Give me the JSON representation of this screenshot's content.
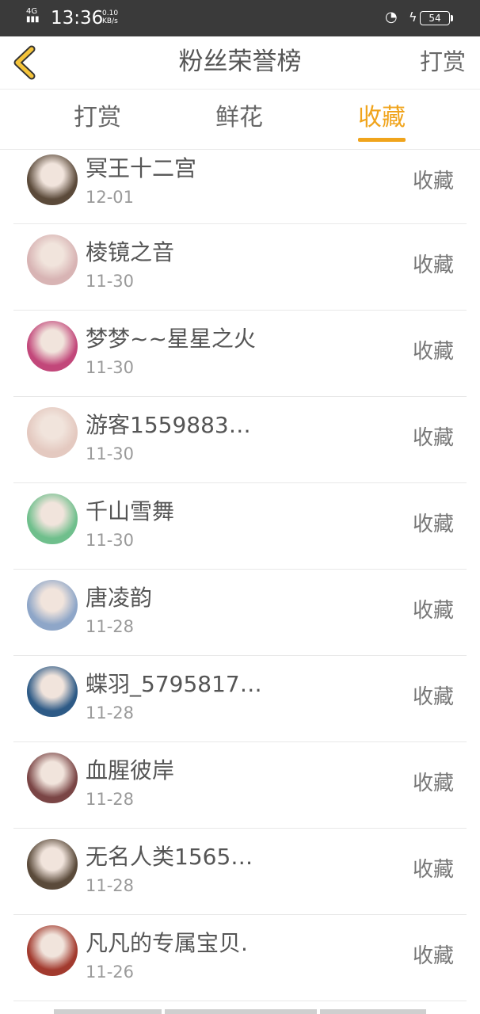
{
  "status": {
    "network": "4G",
    "time": "13:36",
    "speed_value": "0.10",
    "speed_unit": "KB/s",
    "battery": "54"
  },
  "header": {
    "title": "粉丝荣誉榜",
    "right_action": "打赏"
  },
  "tabs": [
    {
      "label": "打赏",
      "active": false
    },
    {
      "label": "鲜花",
      "active": false
    },
    {
      "label": "收藏",
      "active": true
    }
  ],
  "list": [
    {
      "name": "冥王十二宫",
      "date": "12-01",
      "action": "收藏",
      "avatar_color": "#5b4a3a"
    },
    {
      "name": "棱镜之音",
      "date": "11-30",
      "action": "收藏",
      "avatar_color": "#d8b4b4"
    },
    {
      "name": "梦梦~~星星之火",
      "date": "11-30",
      "action": "收藏",
      "avatar_color": "#c2477a"
    },
    {
      "name": "游客1559883…",
      "date": "11-30",
      "action": "收藏",
      "avatar_color": "#e4c9c0"
    },
    {
      "name": "千山雪舞",
      "date": "11-30",
      "action": "收藏",
      "avatar_color": "#6fbf8c"
    },
    {
      "name": "唐凌韵",
      "date": "11-28",
      "action": "收藏",
      "avatar_color": "#8ea6c8"
    },
    {
      "name": "蝶羽_5795817…",
      "date": "11-28",
      "action": "收藏",
      "avatar_color": "#2d5a86"
    },
    {
      "name": "血腥彼岸",
      "date": "11-28",
      "action": "收藏",
      "avatar_color": "#7a4545"
    },
    {
      "name": "无名人类1565…",
      "date": "11-28",
      "action": "收藏",
      "avatar_color": "#5a4a3a"
    },
    {
      "name": "凡凡的专属宝贝.",
      "date": "11-26",
      "action": "收藏",
      "avatar_color": "#a23a2e"
    }
  ],
  "colors": {
    "accent": "#f0a41c",
    "status_bar": "#3a3a3a"
  }
}
